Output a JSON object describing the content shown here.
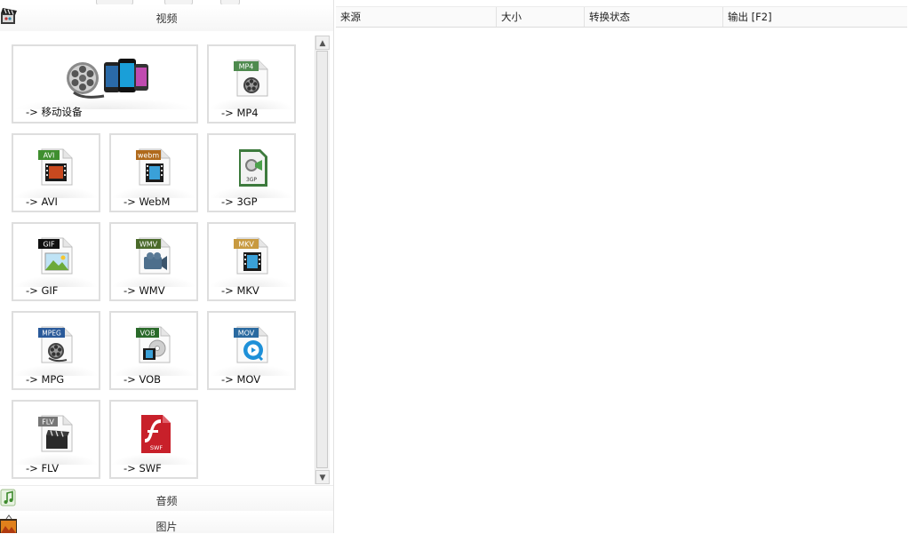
{
  "categories": {
    "video": {
      "label": "视频",
      "icon": "film-clapper-icon"
    },
    "audio": {
      "label": "音频",
      "icon": "music-note-icon"
    },
    "image": {
      "label": "图片",
      "icon": "picture-icon"
    }
  },
  "tiles": [
    {
      "label": "-> 移动设备",
      "icon": "mobile-devices-icon"
    },
    {
      "label": "-> MP4",
      "badge": "MP4",
      "icon": "mp4-file-icon"
    },
    {
      "label": "-> AVI",
      "badge": "AVI",
      "icon": "avi-file-icon"
    },
    {
      "label": "-> WebM",
      "badge": "webm",
      "icon": "webm-file-icon"
    },
    {
      "label": "-> 3GP",
      "badge": "3GP",
      "icon": "3gp-file-icon"
    },
    {
      "label": "-> GIF",
      "badge": "GIF",
      "icon": "gif-file-icon"
    },
    {
      "label": "-> WMV",
      "badge": "WMV",
      "icon": "wmv-file-icon"
    },
    {
      "label": "-> MKV",
      "badge": "MKV",
      "icon": "mkv-file-icon"
    },
    {
      "label": "-> MPG",
      "badge": "MPEG",
      "icon": "mpeg-file-icon"
    },
    {
      "label": "-> VOB",
      "badge": "VOB",
      "icon": "vob-file-icon"
    },
    {
      "label": "-> MOV",
      "badge": "MOV",
      "icon": "mov-file-icon"
    },
    {
      "label": "-> FLV",
      "badge": "FLV",
      "icon": "flv-file-icon"
    },
    {
      "label": "-> SWF",
      "badge": "SWF",
      "icon": "swf-file-icon"
    }
  ],
  "file_list": {
    "columns": [
      "来源",
      "大小",
      "转换状态",
      "输出 [F2]"
    ]
  },
  "colors": {
    "tile_border": "#dedede",
    "mp4_badge": "#4e8a4e",
    "avi_badge": "#3f8f2f",
    "webm_badge": "#b06a1c",
    "wmv_badge": "#4a6a2a",
    "mkv_badge": "#c89a40",
    "mpeg_badge": "#2a5a9a",
    "vob_badge": "#2a6a2a",
    "mov_badge": "#2a6aa0",
    "swf_red": "#c8202a"
  }
}
